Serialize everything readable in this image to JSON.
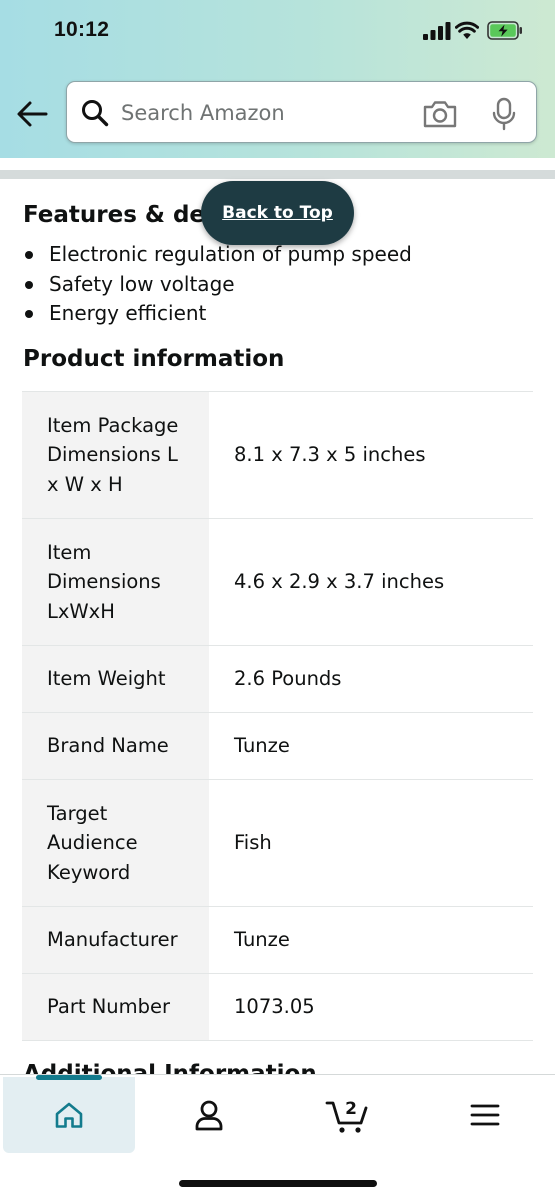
{
  "status_bar": {
    "time": "10:12"
  },
  "search": {
    "placeholder": "Search Amazon"
  },
  "features": {
    "title": "Features & det",
    "bullets": [
      "Electronic regulation of pump speed",
      "Safety low voltage",
      "Energy efficient"
    ]
  },
  "back_to_top": {
    "label": "Back to Top"
  },
  "product_information": {
    "title": "Product information",
    "rows": [
      {
        "key": "Item Package Dimensions L x W x H",
        "value": "8.1 x 7.3 x 5 inches"
      },
      {
        "key": "Item Dimensions LxWxH",
        "value": "4.6 x 2.9 x 3.7 inches"
      },
      {
        "key": "Item Weight",
        "value": "2.6 Pounds"
      },
      {
        "key": "Brand Name",
        "value": "Tunze"
      },
      {
        "key": "Target Audience Keyword",
        "value": "Fish"
      },
      {
        "key": "Manufacturer",
        "value": "Tunze"
      },
      {
        "key": "Part Number",
        "value": "1073.05"
      }
    ]
  },
  "additional_information": {
    "title": "Additional Information"
  },
  "bottom_nav": {
    "items": [
      "home-icon",
      "account-icon",
      "cart-icon",
      "menu-icon"
    ],
    "cart_count": "2",
    "accent": "#137b8d"
  }
}
